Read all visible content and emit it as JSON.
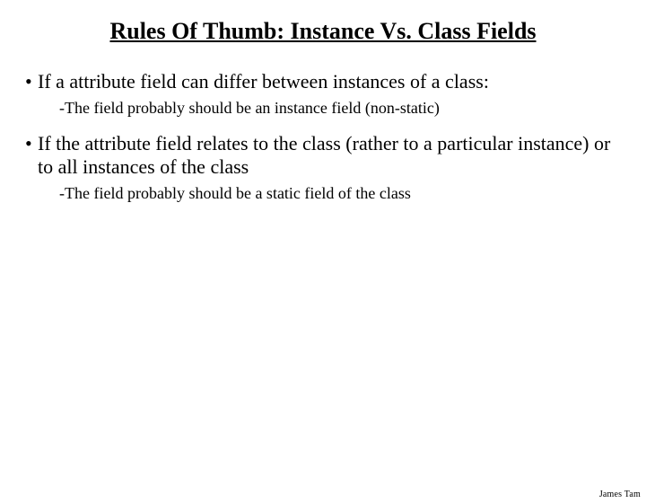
{
  "title": "Rules Of Thumb: Instance Vs. Class Fields",
  "bullets": [
    {
      "text": "If a attribute field can differ between instances of a class:",
      "sub": "-The field probably should be an instance field (non-static)"
    },
    {
      "text": "If the attribute field relates to the class (rather to a particular instance) or to all instances of the class",
      "sub": "-The field probably should be a static field of the class"
    }
  ],
  "footer": "James Tam"
}
